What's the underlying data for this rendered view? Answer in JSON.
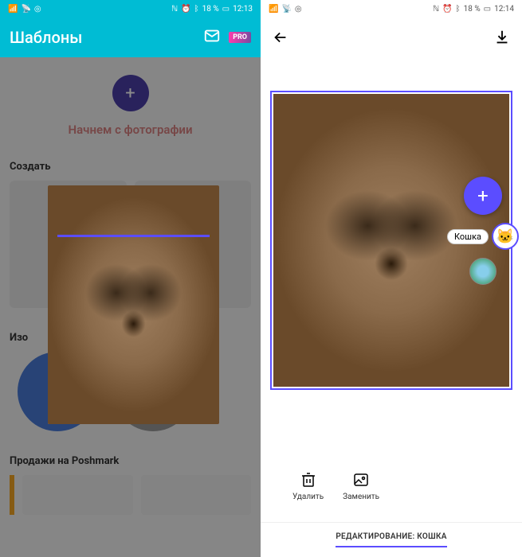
{
  "left": {
    "status": {
      "battery": "18 %",
      "time": "12:13"
    },
    "app_title": "Шаблоны",
    "pro_label": "PRO",
    "cta": "Начнем с фотографии",
    "sections": {
      "create": "Создать",
      "izo": "Изо",
      "poshmark": "Продажи на Poshmark"
    }
  },
  "right": {
    "status": {
      "battery": "18 %",
      "time": "12:14"
    },
    "object_label": "Кошка",
    "object_emoji": "🐱",
    "actions": {
      "delete": "Удалить",
      "replace": "Заменить"
    },
    "edit_bar": "РЕДАКТИРОВАНИЕ: КОШКА"
  },
  "colors": {
    "primary": "#00bcd4",
    "accent": "#5b4dff"
  }
}
